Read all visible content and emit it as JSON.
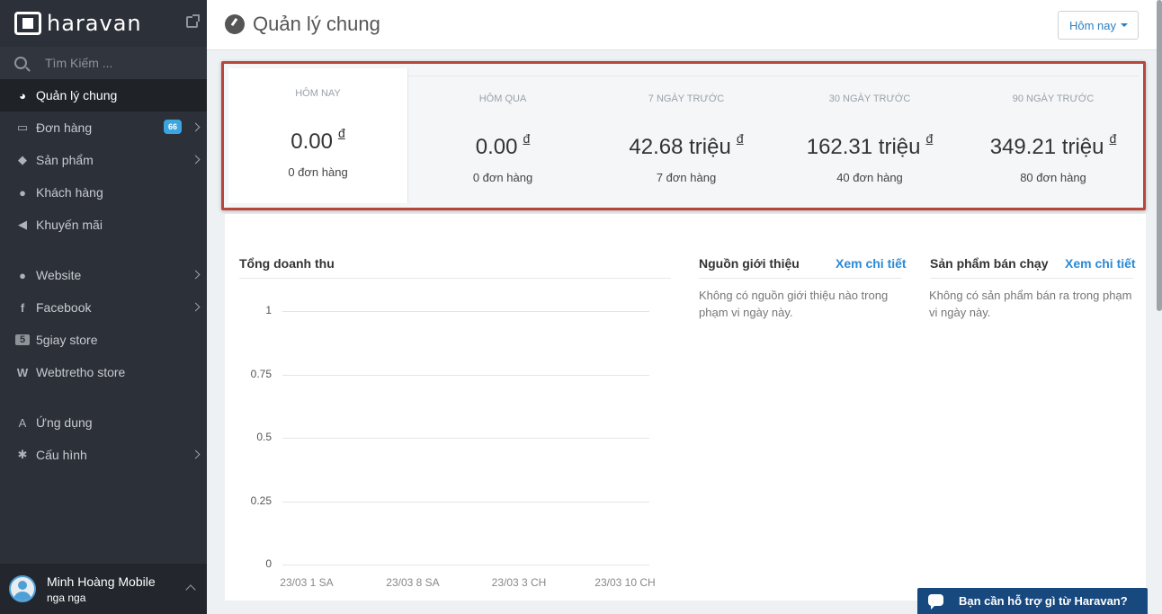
{
  "sidebar": {
    "brand": "haravan",
    "search_placeholder": "Tìm Kiếm ...",
    "items": [
      {
        "label": "Quản lý chung",
        "icon": "dashboard-icon"
      },
      {
        "label": "Đơn hàng",
        "icon": "inbox-icon",
        "badge": "66"
      },
      {
        "label": "Sản phẩm",
        "icon": "tags-icon"
      },
      {
        "label": "Khách hàng",
        "icon": "users-icon"
      },
      {
        "label": "Khuyến mãi",
        "icon": "megaphone-icon"
      },
      {
        "label": "Website",
        "icon": "globe-icon"
      },
      {
        "label": "Facebook",
        "icon": "facebook-icon"
      },
      {
        "label": "5giay store",
        "icon": "5giay-icon"
      },
      {
        "label": "Webtretho store",
        "icon": "webtretho-icon"
      },
      {
        "label": "Ứng dụng",
        "icon": "apps-icon"
      },
      {
        "label": "Cấu hình",
        "icon": "gear-icon"
      }
    ],
    "user": {
      "name": "Minh Hoàng Mobile",
      "sub": "nga nga"
    }
  },
  "header": {
    "title": "Quản lý chung",
    "period": "Hôm nay"
  },
  "stats": [
    {
      "label": "HÔM NAY",
      "value": "0.00",
      "currency": "đ",
      "orders": "0 đơn hàng"
    },
    {
      "label": "HÔM QUA",
      "value": "0.00",
      "currency": "đ",
      "orders": "0 đơn hàng"
    },
    {
      "label": "7 NGÀY TRƯỚC",
      "value": "42.68 triệu",
      "currency": "đ",
      "orders": "7 đơn hàng"
    },
    {
      "label": "30 NGÀY TRƯỚC",
      "value": "162.31 triệu",
      "currency": "đ",
      "orders": "40 đơn hàng"
    },
    {
      "label": "90 NGÀY TRƯỚC",
      "value": "349.21 triệu",
      "currency": "đ",
      "orders": "80 đơn hàng"
    }
  ],
  "revenue": {
    "title": "Tổng doanh thu"
  },
  "referrals": {
    "title": "Nguồn giới thiệu",
    "link": "Xem chi tiết",
    "empty": "Không có nguồn giới thiệu nào trong phạm vi ngày này."
  },
  "bestsellers": {
    "title": "Sản phẩm bán chạy",
    "link": "Xem chi tiết",
    "empty": "Không có sản phẩm bán ra trong phạm vi ngày này."
  },
  "chart_data": {
    "type": "line",
    "title": "Tổng doanh thu",
    "x": [
      "23/03 1 SA",
      "23/03 8 SA",
      "23/03 3 CH",
      "23/03 10 CH"
    ],
    "y_ticks": [
      "1",
      "0.75",
      "0.5",
      "0.25",
      "0"
    ],
    "ylim": [
      0,
      1
    ],
    "series": [],
    "grid": true
  },
  "chat": {
    "label": "Bạn cần hỗ trợ gì từ Haravan?"
  },
  "colors": {
    "sidebar_bg": "#2c3038",
    "accent_blue": "#2a8ad6",
    "highlight_border": "#b8463a",
    "chat_bg": "#17497e"
  }
}
